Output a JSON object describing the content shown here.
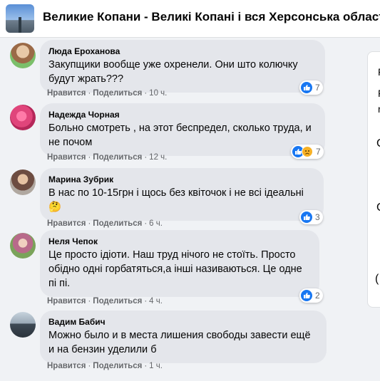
{
  "group": {
    "title": "Великие Копани - Великі Копані і вся Херсонська область"
  },
  "comments": [
    {
      "author": "Люда Ероханова",
      "text": "Закупщики вообще уже охренели. Они што колючку будут жрать???",
      "like_label": "Нравится",
      "reply_label": "Поделиться",
      "time": "10 ч.",
      "reactions": "7",
      "avatar_color": "#c9a27a"
    },
    {
      "author": "Надежда Чорная",
      "text": "Больно смотреть , на этот беспредел, сколько труда, и не почом",
      "like_label": "Нравится",
      "reply_label": "Поделиться",
      "time": "12 ч.",
      "reactions": "7",
      "avatar_color": "#e0457b"
    },
    {
      "author": "Марина Зубрик",
      "text": "В нас по 10-15грн і щось без квіточок і не всі ідеальні 🤔",
      "like_label": "Нравится",
      "reply_label": "Поделиться",
      "time": "6 ч.",
      "reactions": "3",
      "avatar_color": "#8d6e63"
    },
    {
      "author": "Неля Чепок",
      "text": "Це просто ідіоти. Наш труд нічого не стоїть. Просто обідно одні горбатяться,а інші називаються. Це одне пі пі.",
      "like_label": "Нравится",
      "reply_label": "Поделиться",
      "time": "4 ч.",
      "reactions": "2",
      "avatar_color": "#b86a8a"
    },
    {
      "author": "Вадим Бабич",
      "text": "Можно было и в места лишения свободы завести ещё и на бензин уделили б",
      "like_label": "Нравится",
      "reply_label": "Поделиться",
      "time": "1 ч.",
      "reactions": "",
      "avatar_color": "#5b6b7a"
    }
  ],
  "separator": "·",
  "right_panel": {
    "letters": [
      "F",
      "F",
      "r",
      "C",
      "C",
      "("
    ]
  },
  "colors": {
    "bubble": "#e4e6eb",
    "like_blue": "#1877f2",
    "sad_yellow": "#f7b125",
    "meta_gray": "#65676b"
  }
}
